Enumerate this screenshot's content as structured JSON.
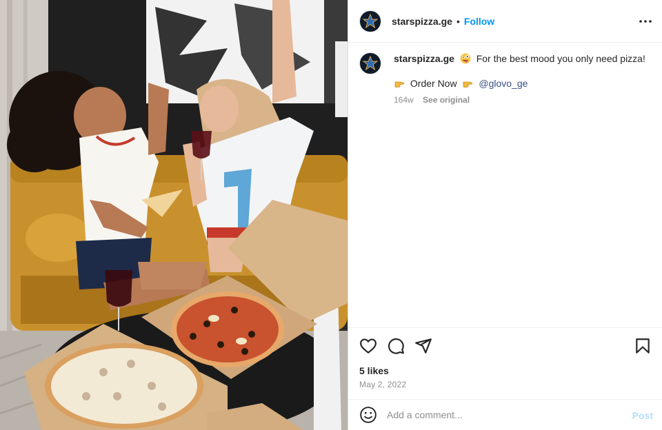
{
  "post": {
    "author": "starspizza.ge",
    "dot": "•",
    "follow_label": "Follow",
    "more_icon": "more-horizontal-icon"
  },
  "caption": {
    "username": "starspizza.ge",
    "text": "For the best mood you only need pizza!",
    "cta_text": "Order Now",
    "mention": "@glovo_ge",
    "age": "164w",
    "see_original": "See original"
  },
  "actions": {
    "like_icon": "heart-icon",
    "comment_icon": "comment-icon",
    "share_icon": "share-icon",
    "save_icon": "bookmark-icon"
  },
  "engagement": {
    "likes": "5 likes",
    "date": "May 2, 2022"
  },
  "comment": {
    "placeholder": "Add a comment...",
    "post_label": "Post"
  },
  "colors": {
    "follow": "#0095f6",
    "post_disabled": "#b2dffc",
    "secondary": "#8e8e8e",
    "link": "#385185"
  }
}
